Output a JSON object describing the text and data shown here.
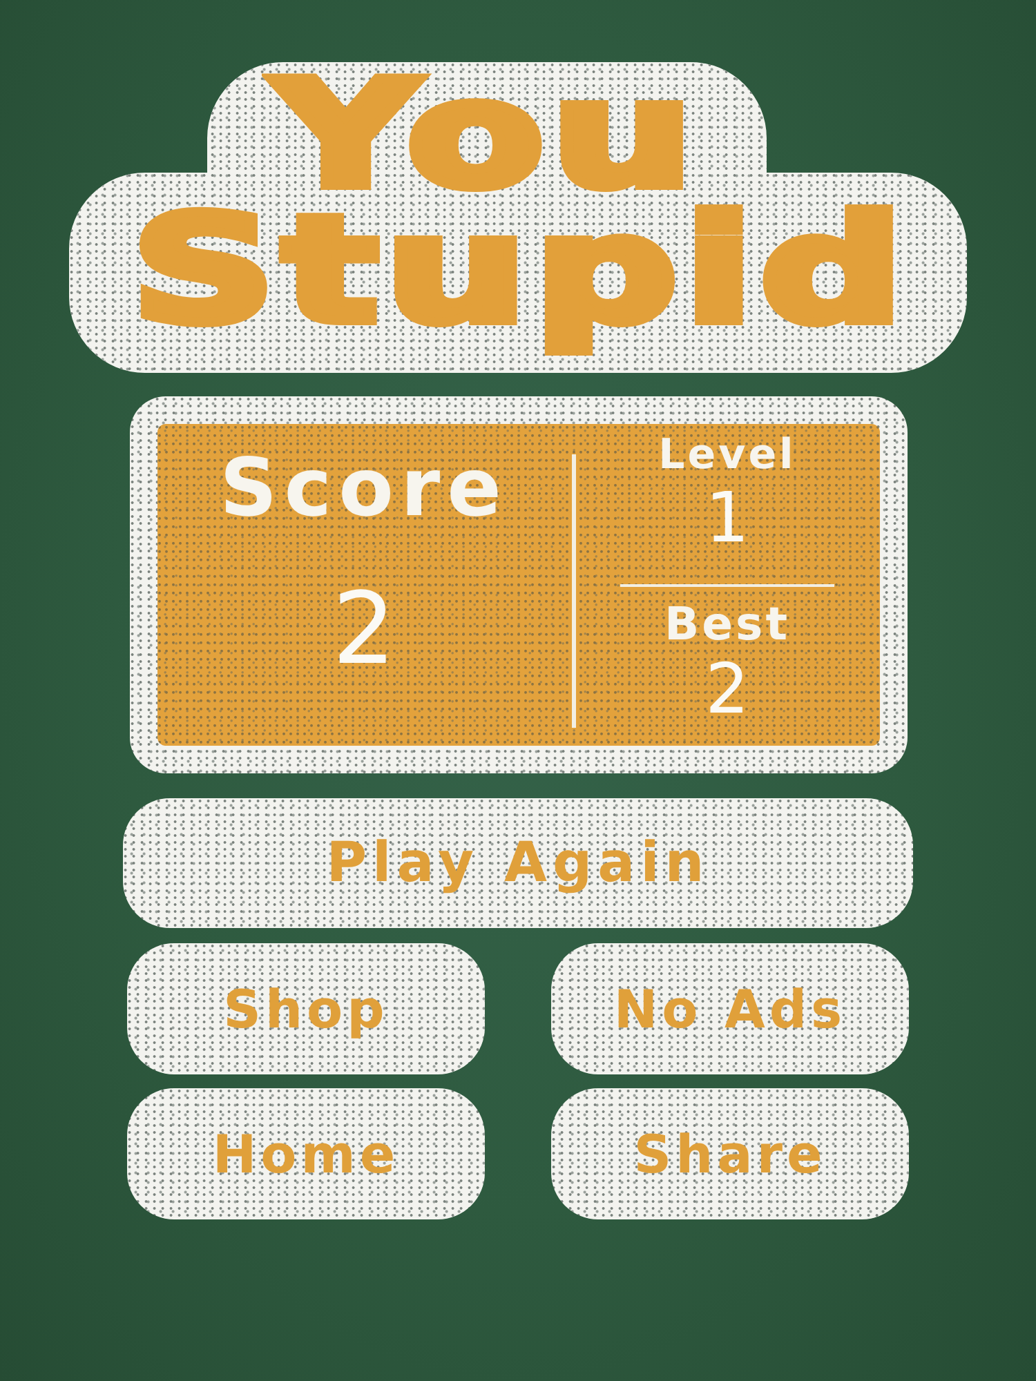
{
  "title": {
    "lines": [
      "You",
      "Stupid"
    ]
  },
  "scoreboard": {
    "score": {
      "label": "Score",
      "value": "2"
    },
    "side_stats": [
      {
        "label": "Level",
        "value": "1"
      },
      {
        "label": "Best",
        "value": "2"
      }
    ]
  },
  "primary_button": {
    "label": "Play Again"
  },
  "buttons": [
    {
      "label": "Shop"
    },
    {
      "label": "No Ads"
    },
    {
      "label": "Home"
    },
    {
      "label": "Share"
    }
  ]
}
